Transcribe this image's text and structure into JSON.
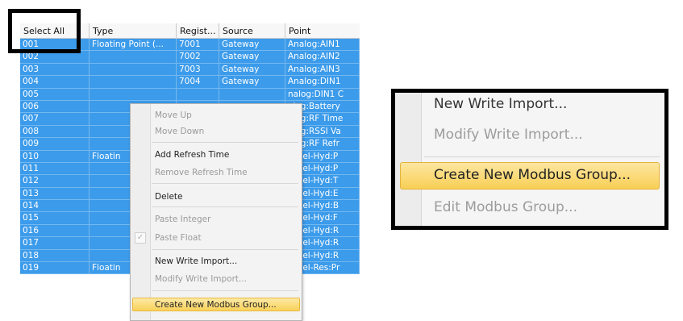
{
  "table": {
    "columns": [
      "Select All",
      "Type",
      "Regist...",
      "Source",
      "Point"
    ],
    "rows": [
      [
        "001",
        "Floating Point (...",
        "7001",
        "Gateway",
        "Analog:AIN1"
      ],
      [
        "002",
        "",
        "7002",
        "Gateway",
        "Analog:AIN2"
      ],
      [
        "003",
        "",
        "7003",
        "Gateway",
        "Analog:AIN3"
      ],
      [
        "004",
        "",
        "7004",
        "Gateway",
        "Analog:DIN1"
      ],
      [
        "005",
        "",
        "",
        "",
        "nalog:DIN1 C"
      ],
      [
        "006",
        "",
        "",
        "",
        "alog:Battery"
      ],
      [
        "007",
        "",
        "",
        "",
        "alog:RF Time"
      ],
      [
        "008",
        "",
        "",
        "",
        "alog:RSSI Va"
      ],
      [
        "009",
        "",
        "",
        "",
        "alog:RF Refr"
      ],
      [
        "010",
        "Floatin",
        "",
        "",
        "Level-Hyd:P"
      ],
      [
        "011",
        "",
        "",
        "",
        "Level-Hyd:P"
      ],
      [
        "012",
        "",
        "",
        "",
        "Level-Hyd:T"
      ],
      [
        "013",
        "",
        "",
        "",
        "Level-Hyd:E"
      ],
      [
        "014",
        "",
        "",
        "",
        "Level-Hyd:B"
      ],
      [
        "015",
        "",
        "",
        "",
        "Level-Hyd:F"
      ],
      [
        "016",
        "",
        "",
        "",
        "Level-Hyd:R"
      ],
      [
        "017",
        "",
        "",
        "",
        "Level-Hyd:R"
      ],
      [
        "018",
        "",
        "",
        "",
        "Level-Hyd:R"
      ],
      [
        "019",
        "Floatin",
        "",
        "",
        "Level-Res:Pr"
      ]
    ]
  },
  "context_menu": {
    "move_up": "Move Up",
    "move_down": "Move Down",
    "add_refresh_time": "Add Refresh Time",
    "remove_refresh_time": "Remove Refresh Time",
    "delete": "Delete",
    "paste_integer": "Paste Integer",
    "paste_float": "Paste Float",
    "new_write_import": "New Write Import...",
    "modify_write_import": "Modify Write Import...",
    "create_new_modbus_group": "Create New Modbus Group..."
  },
  "zoom_menu": {
    "new_write_import": "New Write Import...",
    "modify_write_import": "Modify Write Import...",
    "create_new_modbus_group": "Create New Modbus Group...",
    "edit_modbus_group": "Edit Modbus Group..."
  },
  "colors": {
    "selection": "#3c9bea",
    "menu_highlight": "#f9d25b",
    "callout_border": "#000000"
  }
}
